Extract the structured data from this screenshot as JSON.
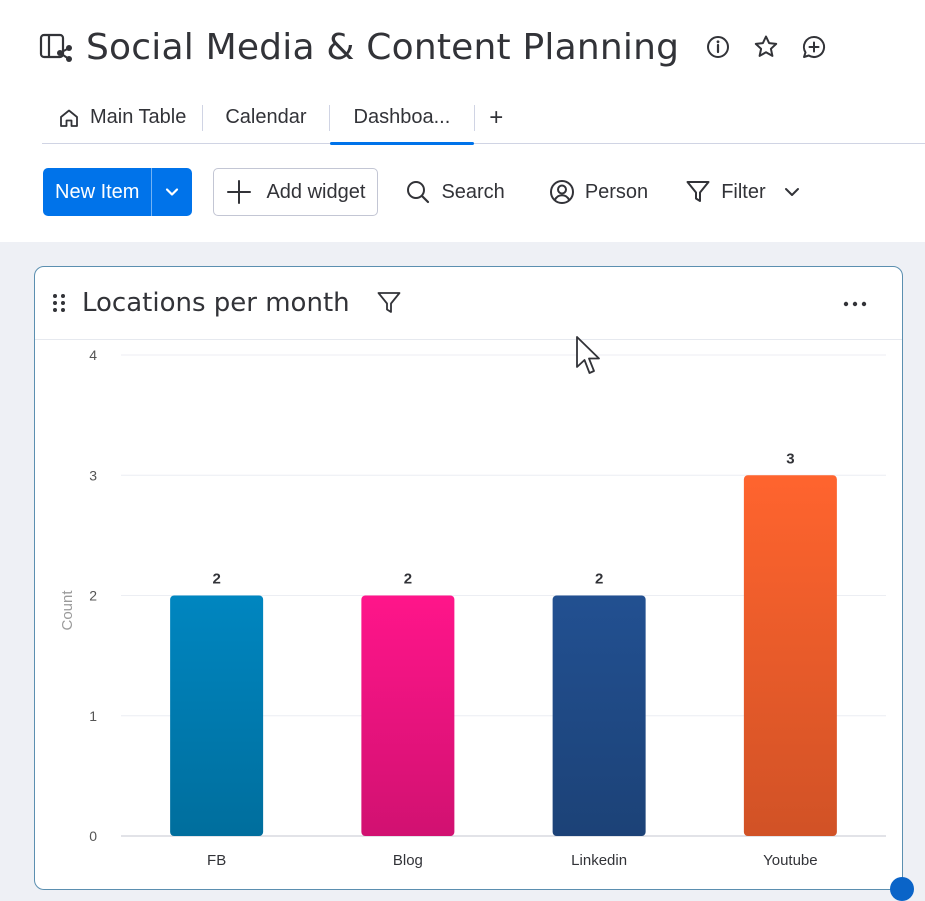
{
  "header": {
    "title": "Social Media & Content Planning",
    "icons": [
      "board-share-icon",
      "info-icon",
      "star-icon",
      "chat-add-icon"
    ]
  },
  "tabs": [
    {
      "label": "Main Table",
      "icon": "home-icon",
      "active": false
    },
    {
      "label": "Calendar",
      "active": false
    },
    {
      "label": "Dashboa...",
      "active": true
    }
  ],
  "tab_add_label": "+",
  "toolbar": {
    "new_item_label": "New Item",
    "add_widget_label": "Add widget",
    "search_label": "Search",
    "person_label": "Person",
    "filter_label": "Filter"
  },
  "widget": {
    "title": "Locations per month"
  },
  "colors": {
    "accent": "#0073ea",
    "fb": "#0086c0",
    "blog": "#ff158a",
    "linkedin": "#225091",
    "youtube": "#ff642e"
  },
  "chart_data": {
    "type": "bar",
    "categories": [
      "FB",
      "Blog",
      "Linkedin",
      "Youtube"
    ],
    "values": [
      2,
      2,
      2,
      3
    ],
    "colors": [
      "#0086c0",
      "#ff158a",
      "#225091",
      "#ff642e"
    ],
    "title": "",
    "xlabel": "",
    "ylabel": "Count",
    "ylim": [
      0,
      4
    ],
    "yticks": [
      0,
      1,
      2,
      3,
      4
    ],
    "data_labels": true,
    "grid": true,
    "legend": "none"
  }
}
